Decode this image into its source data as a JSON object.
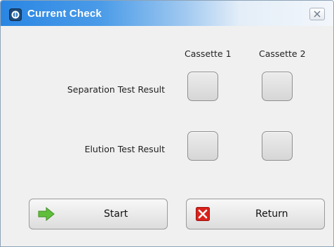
{
  "window": {
    "title": "Current Check",
    "close_glyph": "✕"
  },
  "columns": [
    "Cassette 1",
    "Cassette 2"
  ],
  "rows": [
    {
      "label": "Separation Test Result"
    },
    {
      "label": "Elution Test Result"
    }
  ],
  "buttons": {
    "start_label": "Start",
    "return_label": "Return"
  },
  "icons": {
    "app": "app-logo-icon",
    "start": "green-arrow-right-icon",
    "return": "red-x-icon",
    "close": "close-icon"
  },
  "colors": {
    "title_bar": "#2a86e3",
    "start_icon": "#5fbf3a",
    "return_icon": "#d9221c"
  }
}
